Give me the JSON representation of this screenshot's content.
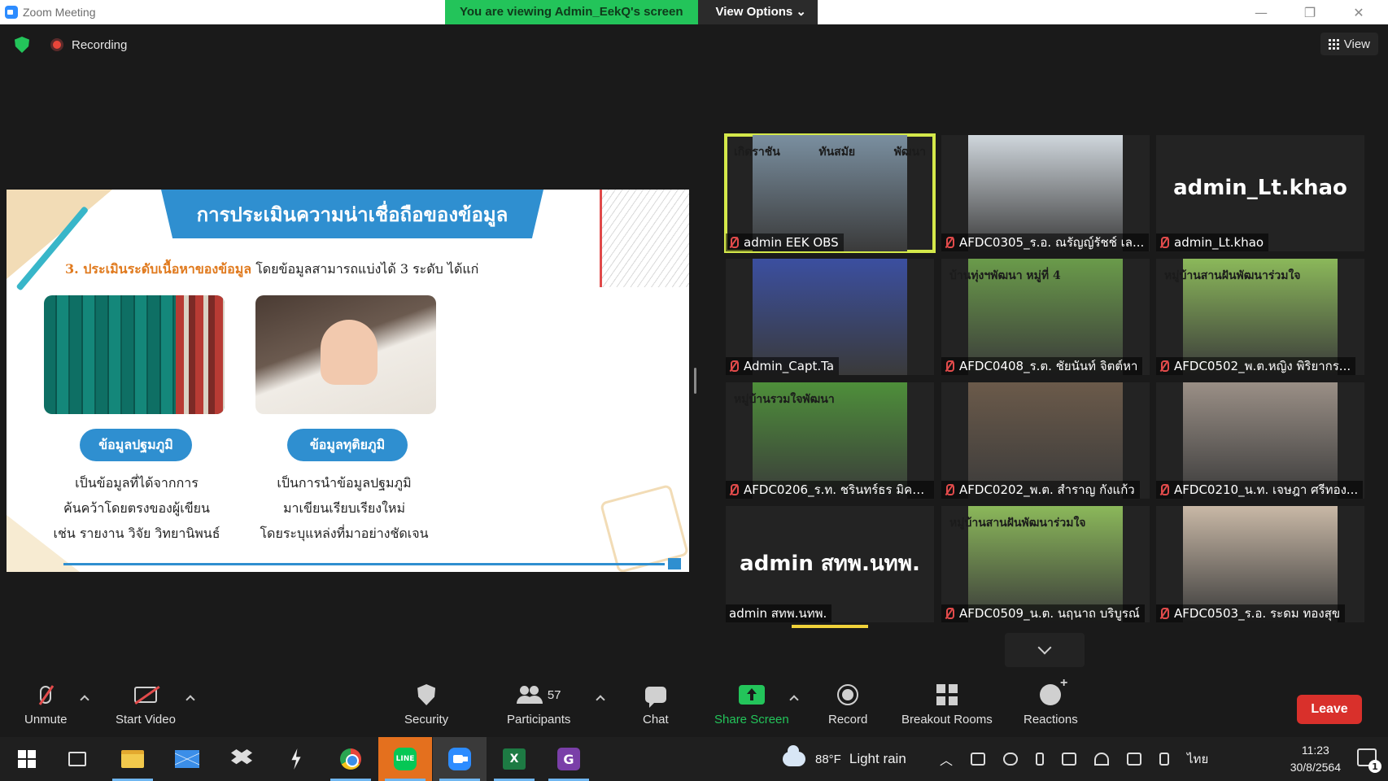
{
  "window": {
    "title": "Zoom Meeting",
    "viewing_banner": "You are viewing Admin_EekQ's screen",
    "view_options_label": "View Options ⌄",
    "minimize_symbol": "—",
    "restore_symbol": "❐",
    "close_symbol": "✕"
  },
  "meeting": {
    "recording_label": "Recording",
    "view_label": "View"
  },
  "slide": {
    "title": "การประเมินความน่าเชื่อถือของข้อมูล",
    "subtitle_highlight": "3. ประเมินระดับเนื้อหาของข้อมูล",
    "subtitle_rest": " โดยข้อมูลสามารถแบ่งได้ 3 ระดับ ได้แก่",
    "primary_label": "ข้อมูลปฐมภูมิ",
    "primary_desc": [
      "เป็นข้อมูลที่ได้จากการ",
      "ค้นคว้าโดยตรงของผู้เขียน",
      "เช่น รายงาน วิจัย วิทยานิพนธ์"
    ],
    "secondary_label": "ข้อมูลทุติยภูมิ",
    "secondary_desc": [
      "เป็นการนำข้อมูลปฐมภูมิ",
      "มาเขียนเรียบเรียงใหม่",
      "โดยระบุแหล่งที่มาอย่างชัดเจน"
    ]
  },
  "participants_tiles": [
    {
      "name": "admin EEK OBS",
      "active": true,
      "muted": true,
      "bg": "#7a8fa0",
      "banner": [
        "เกิดราชัน",
        "ทันสมัย",
        "พัฒนา"
      ]
    },
    {
      "name": "AFDC0305_ร.อ. ณรัญญ์รัชช์  เล...",
      "muted": true,
      "bg": "#cfd6dc"
    },
    {
      "name": "admin_Lt.khao",
      "muted": true,
      "namecard": "admin_Lt.khao",
      "bg": "#232323"
    },
    {
      "name": "Admin_Capt.Ta",
      "muted": true,
      "bg": "#3b4fa0"
    },
    {
      "name": "AFDC0408_ร.ต. ชัยนันท์  จิตต์หา",
      "muted": true,
      "bg": "#6a9b4a",
      "banner": [
        "บ้านทุ่งฯพัฒนา หมู่ที่ 4"
      ]
    },
    {
      "name": "AFDC0502_พ.ต.หญิง พิริยากร...",
      "muted": true,
      "bg": "#8bb85a",
      "banner": [
        "หมู่บ้านสานฝันพัฒนาร่วมใจ"
      ]
    },
    {
      "name": "AFDC0206_ร.ท. ชรินทร์ธร  มิคร...",
      "muted": true,
      "bg": "#4e8f3a",
      "banner": [
        "หมู่บ้านรวมใจพัฒนา"
      ]
    },
    {
      "name": "AFDC0202_พ.ต. สำราญ  กังแก้ว",
      "muted": true,
      "bg": "#6b5a4a"
    },
    {
      "name": "AFDC0210_น.ท. เจษฎา  ศรีทอง...",
      "muted": true,
      "bg": "#9a8f86"
    },
    {
      "name": "admin สทพ.นทพ.",
      "muted": false,
      "namecard": "admin สทพ.นทพ.",
      "bg": "#232323"
    },
    {
      "name": "AFDC0509_น.ต. นฤนาถ  บริบูรณ์",
      "muted": true,
      "bg": "#8bb85a",
      "banner": [
        "หมู่บ้านสานฝันพัฒนาร่วมใจ"
      ]
    },
    {
      "name": "AFDC0503_ร.อ. ระดม  ทองสุข",
      "muted": true,
      "bg": "#c9b8a6"
    }
  ],
  "toolbar": {
    "unmute": "Unmute",
    "start_video": "Start Video",
    "security": "Security",
    "participants": "Participants",
    "participants_count": "57",
    "chat": "Chat",
    "share_screen": "Share Screen",
    "record": "Record",
    "breakout_rooms": "Breakout Rooms",
    "reactions": "Reactions",
    "leave": "Leave",
    "share_color": "#23c45a",
    "leave_color": "#d9302b"
  },
  "taskbar": {
    "weather_temp": "88°F",
    "weather_text": "Light rain",
    "language": "ไทย",
    "time": "11:23",
    "date": "30/8/2564",
    "notifications": "1",
    "line_label": "LINE",
    "excel_label": "X",
    "pdf_label": "G"
  }
}
